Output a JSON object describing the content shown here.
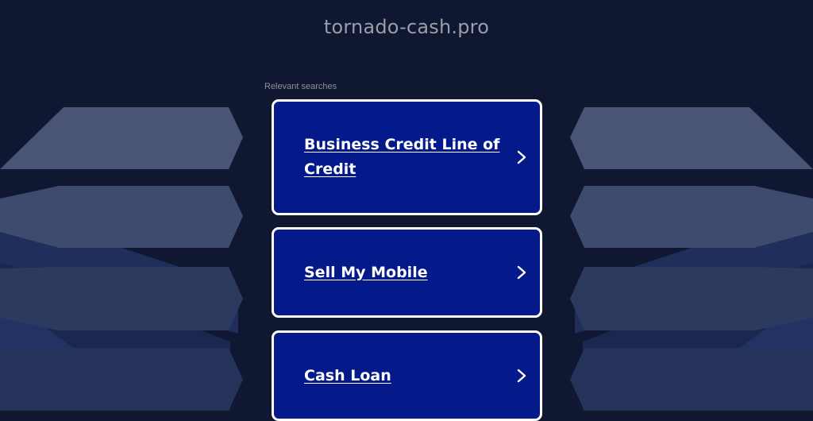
{
  "page": {
    "domain": "tornado-cash.pro",
    "relevant_label": "Relevant searches"
  },
  "searches": [
    {
      "label": "Business Credit Line of Credit",
      "icon": "chevron-right-icon"
    },
    {
      "label": "Sell My Mobile",
      "icon": "chevron-right-icon"
    },
    {
      "label": "Cash Loan",
      "icon": "chevron-right-icon"
    }
  ],
  "colors": {
    "background": "#0f1830",
    "card": "#041a8a",
    "card_border": "#ffffff",
    "title_text": "#9a9ea8"
  }
}
